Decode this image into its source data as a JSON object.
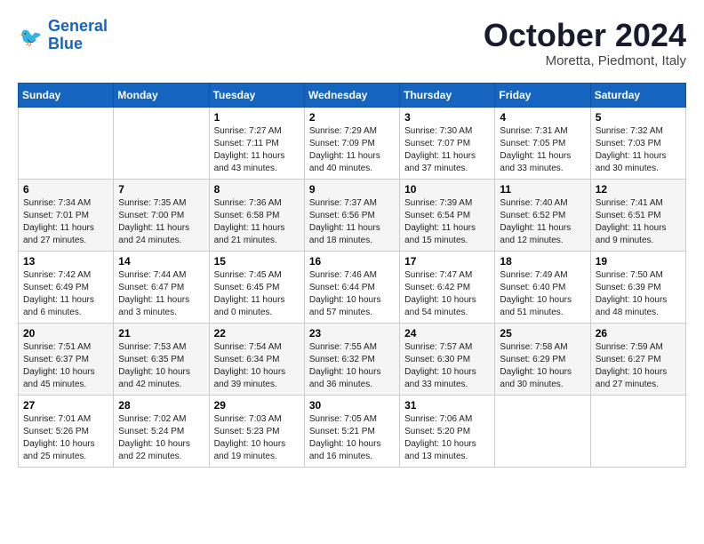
{
  "header": {
    "logo_line1": "General",
    "logo_line2": "Blue",
    "month_title": "October 2024",
    "location": "Moretta, Piedmont, Italy"
  },
  "days_of_week": [
    "Sunday",
    "Monday",
    "Tuesday",
    "Wednesday",
    "Thursday",
    "Friday",
    "Saturday"
  ],
  "weeks": [
    [
      {
        "day": "",
        "sunrise": "",
        "sunset": "",
        "daylight": ""
      },
      {
        "day": "",
        "sunrise": "",
        "sunset": "",
        "daylight": ""
      },
      {
        "day": "1",
        "sunrise": "Sunrise: 7:27 AM",
        "sunset": "Sunset: 7:11 PM",
        "daylight": "Daylight: 11 hours and 43 minutes."
      },
      {
        "day": "2",
        "sunrise": "Sunrise: 7:29 AM",
        "sunset": "Sunset: 7:09 PM",
        "daylight": "Daylight: 11 hours and 40 minutes."
      },
      {
        "day": "3",
        "sunrise": "Sunrise: 7:30 AM",
        "sunset": "Sunset: 7:07 PM",
        "daylight": "Daylight: 11 hours and 37 minutes."
      },
      {
        "day": "4",
        "sunrise": "Sunrise: 7:31 AM",
        "sunset": "Sunset: 7:05 PM",
        "daylight": "Daylight: 11 hours and 33 minutes."
      },
      {
        "day": "5",
        "sunrise": "Sunrise: 7:32 AM",
        "sunset": "Sunset: 7:03 PM",
        "daylight": "Daylight: 11 hours and 30 minutes."
      }
    ],
    [
      {
        "day": "6",
        "sunrise": "Sunrise: 7:34 AM",
        "sunset": "Sunset: 7:01 PM",
        "daylight": "Daylight: 11 hours and 27 minutes."
      },
      {
        "day": "7",
        "sunrise": "Sunrise: 7:35 AM",
        "sunset": "Sunset: 7:00 PM",
        "daylight": "Daylight: 11 hours and 24 minutes."
      },
      {
        "day": "8",
        "sunrise": "Sunrise: 7:36 AM",
        "sunset": "Sunset: 6:58 PM",
        "daylight": "Daylight: 11 hours and 21 minutes."
      },
      {
        "day": "9",
        "sunrise": "Sunrise: 7:37 AM",
        "sunset": "Sunset: 6:56 PM",
        "daylight": "Daylight: 11 hours and 18 minutes."
      },
      {
        "day": "10",
        "sunrise": "Sunrise: 7:39 AM",
        "sunset": "Sunset: 6:54 PM",
        "daylight": "Daylight: 11 hours and 15 minutes."
      },
      {
        "day": "11",
        "sunrise": "Sunrise: 7:40 AM",
        "sunset": "Sunset: 6:52 PM",
        "daylight": "Daylight: 11 hours and 12 minutes."
      },
      {
        "day": "12",
        "sunrise": "Sunrise: 7:41 AM",
        "sunset": "Sunset: 6:51 PM",
        "daylight": "Daylight: 11 hours and 9 minutes."
      }
    ],
    [
      {
        "day": "13",
        "sunrise": "Sunrise: 7:42 AM",
        "sunset": "Sunset: 6:49 PM",
        "daylight": "Daylight: 11 hours and 6 minutes."
      },
      {
        "day": "14",
        "sunrise": "Sunrise: 7:44 AM",
        "sunset": "Sunset: 6:47 PM",
        "daylight": "Daylight: 11 hours and 3 minutes."
      },
      {
        "day": "15",
        "sunrise": "Sunrise: 7:45 AM",
        "sunset": "Sunset: 6:45 PM",
        "daylight": "Daylight: 11 hours and 0 minutes."
      },
      {
        "day": "16",
        "sunrise": "Sunrise: 7:46 AM",
        "sunset": "Sunset: 6:44 PM",
        "daylight": "Daylight: 10 hours and 57 minutes."
      },
      {
        "day": "17",
        "sunrise": "Sunrise: 7:47 AM",
        "sunset": "Sunset: 6:42 PM",
        "daylight": "Daylight: 10 hours and 54 minutes."
      },
      {
        "day": "18",
        "sunrise": "Sunrise: 7:49 AM",
        "sunset": "Sunset: 6:40 PM",
        "daylight": "Daylight: 10 hours and 51 minutes."
      },
      {
        "day": "19",
        "sunrise": "Sunrise: 7:50 AM",
        "sunset": "Sunset: 6:39 PM",
        "daylight": "Daylight: 10 hours and 48 minutes."
      }
    ],
    [
      {
        "day": "20",
        "sunrise": "Sunrise: 7:51 AM",
        "sunset": "Sunset: 6:37 PM",
        "daylight": "Daylight: 10 hours and 45 minutes."
      },
      {
        "day": "21",
        "sunrise": "Sunrise: 7:53 AM",
        "sunset": "Sunset: 6:35 PM",
        "daylight": "Daylight: 10 hours and 42 minutes."
      },
      {
        "day": "22",
        "sunrise": "Sunrise: 7:54 AM",
        "sunset": "Sunset: 6:34 PM",
        "daylight": "Daylight: 10 hours and 39 minutes."
      },
      {
        "day": "23",
        "sunrise": "Sunrise: 7:55 AM",
        "sunset": "Sunset: 6:32 PM",
        "daylight": "Daylight: 10 hours and 36 minutes."
      },
      {
        "day": "24",
        "sunrise": "Sunrise: 7:57 AM",
        "sunset": "Sunset: 6:30 PM",
        "daylight": "Daylight: 10 hours and 33 minutes."
      },
      {
        "day": "25",
        "sunrise": "Sunrise: 7:58 AM",
        "sunset": "Sunset: 6:29 PM",
        "daylight": "Daylight: 10 hours and 30 minutes."
      },
      {
        "day": "26",
        "sunrise": "Sunrise: 7:59 AM",
        "sunset": "Sunset: 6:27 PM",
        "daylight": "Daylight: 10 hours and 27 minutes."
      }
    ],
    [
      {
        "day": "27",
        "sunrise": "Sunrise: 7:01 AM",
        "sunset": "Sunset: 5:26 PM",
        "daylight": "Daylight: 10 hours and 25 minutes."
      },
      {
        "day": "28",
        "sunrise": "Sunrise: 7:02 AM",
        "sunset": "Sunset: 5:24 PM",
        "daylight": "Daylight: 10 hours and 22 minutes."
      },
      {
        "day": "29",
        "sunrise": "Sunrise: 7:03 AM",
        "sunset": "Sunset: 5:23 PM",
        "daylight": "Daylight: 10 hours and 19 minutes."
      },
      {
        "day": "30",
        "sunrise": "Sunrise: 7:05 AM",
        "sunset": "Sunset: 5:21 PM",
        "daylight": "Daylight: 10 hours and 16 minutes."
      },
      {
        "day": "31",
        "sunrise": "Sunrise: 7:06 AM",
        "sunset": "Sunset: 5:20 PM",
        "daylight": "Daylight: 10 hours and 13 minutes."
      },
      {
        "day": "",
        "sunrise": "",
        "sunset": "",
        "daylight": ""
      },
      {
        "day": "",
        "sunrise": "",
        "sunset": "",
        "daylight": ""
      }
    ]
  ]
}
